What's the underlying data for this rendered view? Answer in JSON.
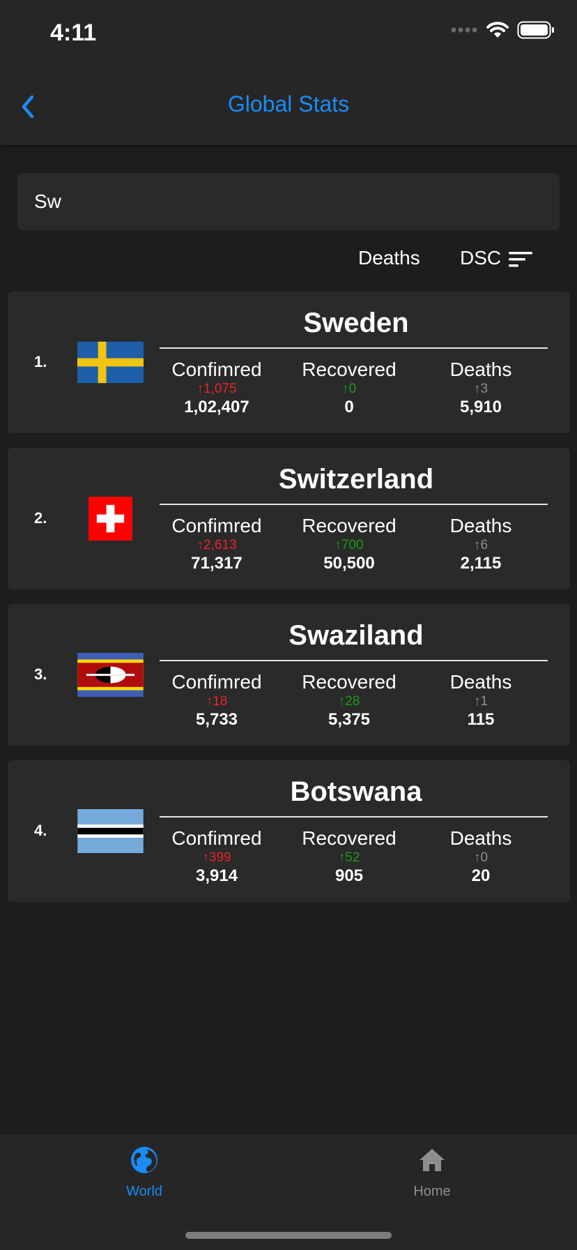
{
  "status": {
    "time": "4:11"
  },
  "nav": {
    "title": "Global Stats"
  },
  "search": {
    "value": "Sw"
  },
  "sort": {
    "field": "Deaths",
    "order": "DSC"
  },
  "colors": {
    "accent": "#1a8cf5",
    "increase": "#e8242a",
    "recovered_delta": "#1c9a1c",
    "deaths_delta": "#8e8e8e"
  },
  "countries": [
    {
      "rank": "1.",
      "name": "Sweden",
      "flag": "sweden-flag",
      "confirmed": {
        "label": "Confimred",
        "delta": "↑1,075",
        "value": "1,02,407"
      },
      "recovered": {
        "label": "Recovered",
        "delta": "↑0",
        "value": "0"
      },
      "deaths": {
        "label": "Deaths",
        "delta": "↑3",
        "value": "5,910"
      }
    },
    {
      "rank": "2.",
      "name": "Switzerland",
      "flag": "switzerland-flag",
      "confirmed": {
        "label": "Confimred",
        "delta": "↑2,613",
        "value": "71,317"
      },
      "recovered": {
        "label": "Recovered",
        "delta": "↑700",
        "value": "50,500"
      },
      "deaths": {
        "label": "Deaths",
        "delta": "↑6",
        "value": "2,115"
      }
    },
    {
      "rank": "3.",
      "name": "Swaziland",
      "flag": "swaziland-flag",
      "confirmed": {
        "label": "Confimred",
        "delta": "↑18",
        "value": "5,733"
      },
      "recovered": {
        "label": "Recovered",
        "delta": "↑28",
        "value": "5,375"
      },
      "deaths": {
        "label": "Deaths",
        "delta": "↑1",
        "value": "115"
      }
    },
    {
      "rank": "4.",
      "name": "Botswana",
      "flag": "botswana-flag",
      "confirmed": {
        "label": "Confimred",
        "delta": "↑399",
        "value": "3,914"
      },
      "recovered": {
        "label": "Recovered",
        "delta": "↑52",
        "value": "905"
      },
      "deaths": {
        "label": "Deaths",
        "delta": "↑0",
        "value": "20"
      }
    }
  ],
  "tabs": [
    {
      "label": "World",
      "icon": "globe-icon",
      "active": true
    },
    {
      "label": "Home",
      "icon": "home-icon",
      "active": false
    }
  ]
}
